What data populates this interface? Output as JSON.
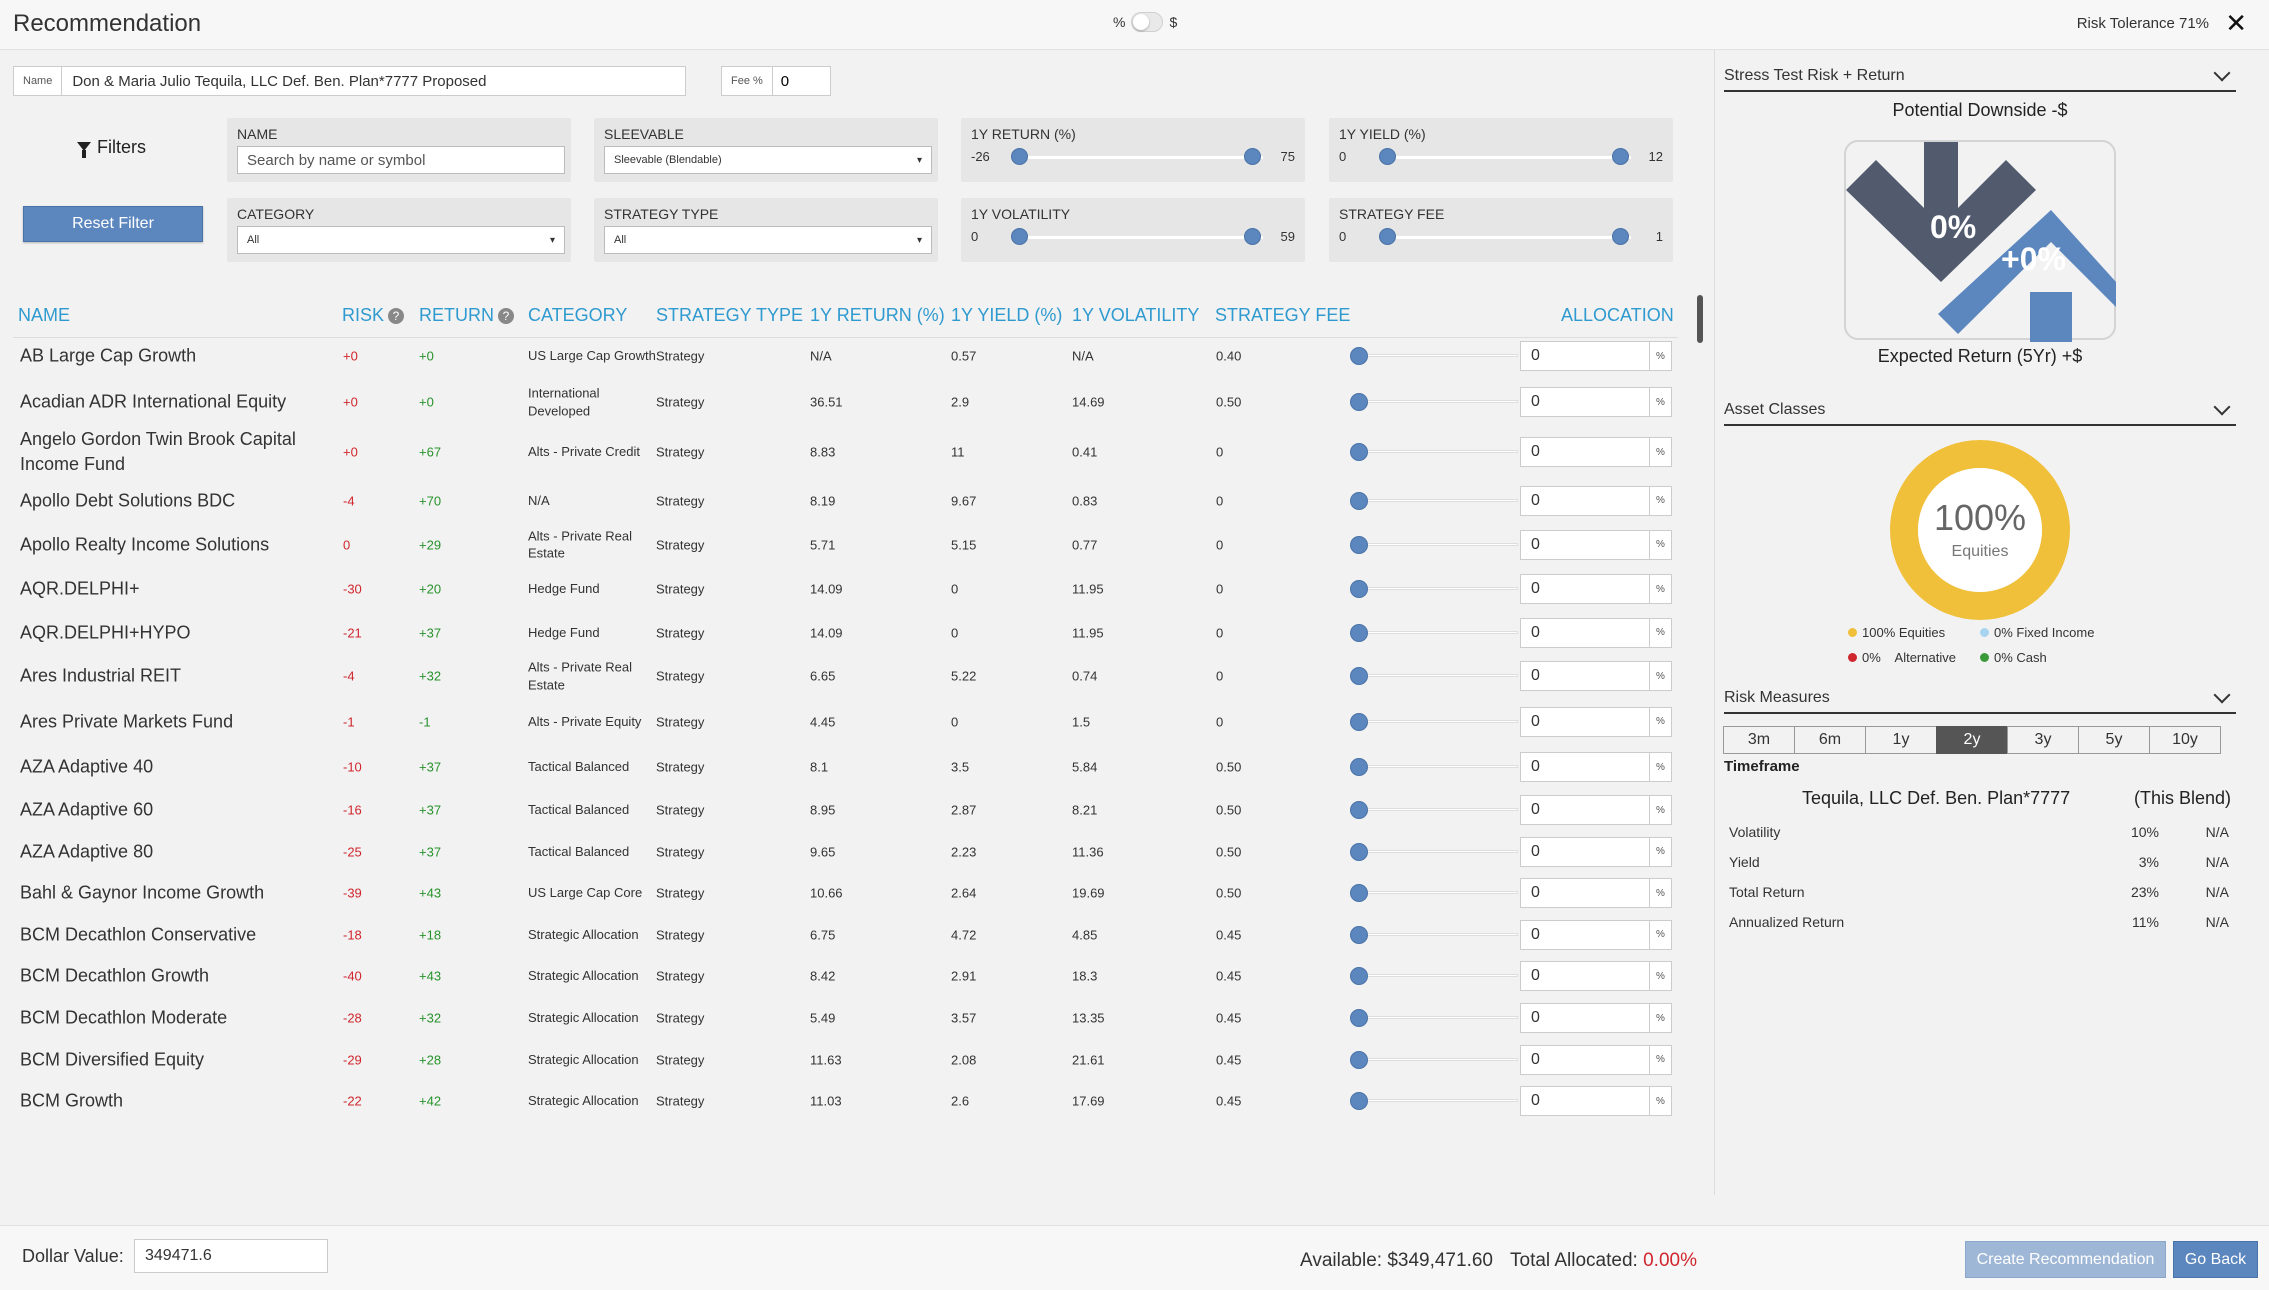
{
  "header": {
    "title": "Recommendation",
    "toggle_left": "%",
    "toggle_right": "$",
    "risk_tolerance": "Risk Tolerance 71%",
    "close_glyph": "✕"
  },
  "form": {
    "name_label": "Name",
    "name_value": "Don & Maria Julio Tequila, LLC Def. Ben. Plan*7777 Proposed",
    "fee_label": "Fee %",
    "fee_value": "0"
  },
  "filters": {
    "title": "Filters",
    "reset_label": "Reset Filter",
    "name": {
      "label": "NAME",
      "placeholder": "Search by name or symbol"
    },
    "sleevable": {
      "label": "SLEEVABLE",
      "selected": "Sleevable (Blendable)"
    },
    "category": {
      "label": "CATEGORY",
      "selected": "All"
    },
    "strategy_type": {
      "label": "STRATEGY TYPE",
      "selected": "All"
    },
    "return_1y": {
      "label": "1Y RETURN (%)",
      "min": "-26",
      "max": "75"
    },
    "yield_1y": {
      "label": "1Y YIELD (%)",
      "min": "0",
      "max": "12"
    },
    "volatility_1y": {
      "label": "1Y VOLATILITY",
      "min": "0",
      "max": "59"
    },
    "strategy_fee": {
      "label": "STRATEGY FEE",
      "min": "0",
      "max": "1"
    }
  },
  "table": {
    "headers": {
      "name": "NAME",
      "risk": "RISK",
      "return": "RETURN",
      "category": "CATEGORY",
      "strategy_type": "STRATEGY TYPE",
      "return_1y": "1Y RETURN (%)",
      "yield_1y": "1Y YIELD (%)",
      "volatility_1y": "1Y VOLATILITY",
      "fee": "STRATEGY FEE",
      "allocation": "ALLOCATION"
    },
    "help_glyph": "?",
    "pct_suffix": "%",
    "rows": [
      {
        "name": "AB Large Cap Growth",
        "risk": "+0",
        "ret": "+0",
        "cat": "US Large Cap Growth",
        "st": "Strategy",
        "r1": "N/A",
        "y1": "0.57",
        "v1": "N/A",
        "fee": "0.40",
        "alloc": "0"
      },
      {
        "name": "Acadian ADR International Equity",
        "risk": "+0",
        "ret": "+0",
        "cat": "International Developed",
        "st": "Strategy",
        "r1": "36.51",
        "y1": "2.9",
        "v1": "14.69",
        "fee": "0.50",
        "alloc": "0"
      },
      {
        "name": "Angelo Gordon Twin Brook Capital Income Fund",
        "risk": "+0",
        "ret": "+67",
        "cat": "Alts - Private Credit",
        "st": "Strategy",
        "r1": "8.83",
        "y1": "11",
        "v1": "0.41",
        "fee": "0",
        "alloc": "0"
      },
      {
        "name": "Apollo Debt Solutions BDC",
        "risk": "-4",
        "ret": "+70",
        "cat": "N/A",
        "st": "Strategy",
        "r1": "8.19",
        "y1": "9.67",
        "v1": "0.83",
        "fee": "0",
        "alloc": "0"
      },
      {
        "name": "Apollo Realty Income Solutions",
        "risk": "0",
        "ret": "+29",
        "cat": "Alts - Private Real Estate",
        "st": "Strategy",
        "r1": "5.71",
        "y1": "5.15",
        "v1": "0.77",
        "fee": "0",
        "alloc": "0"
      },
      {
        "name": "AQR.DELPHI+",
        "risk": "-30",
        "ret": "+20",
        "cat": "Hedge Fund",
        "st": "Strategy",
        "r1": "14.09",
        "y1": "0",
        "v1": "11.95",
        "fee": "0",
        "alloc": "0"
      },
      {
        "name": "AQR.DELPHI+HYPO",
        "risk": "-21",
        "ret": "+37",
        "cat": "Hedge Fund",
        "st": "Strategy",
        "r1": "14.09",
        "y1": "0",
        "v1": "11.95",
        "fee": "0",
        "alloc": "0"
      },
      {
        "name": "Ares Industrial REIT",
        "risk": "-4",
        "ret": "+32",
        "cat": "Alts - Private Real Estate",
        "st": "Strategy",
        "r1": "6.65",
        "y1": "5.22",
        "v1": "0.74",
        "fee": "0",
        "alloc": "0"
      },
      {
        "name": "Ares Private Markets Fund",
        "risk": "-1",
        "ret": "-1",
        "cat": "Alts - Private Equity",
        "st": "Strategy",
        "r1": "4.45",
        "y1": "0",
        "v1": "1.5",
        "fee": "0",
        "alloc": "0"
      },
      {
        "name": "AZA Adaptive 40",
        "risk": "-10",
        "ret": "+37",
        "cat": "Tactical Balanced",
        "st": "Strategy",
        "r1": "8.1",
        "y1": "3.5",
        "v1": "5.84",
        "fee": "0.50",
        "alloc": "0"
      },
      {
        "name": "AZA Adaptive 60",
        "risk": "-16",
        "ret": "+37",
        "cat": "Tactical Balanced",
        "st": "Strategy",
        "r1": "8.95",
        "y1": "2.87",
        "v1": "8.21",
        "fee": "0.50",
        "alloc": "0"
      },
      {
        "name": "AZA Adaptive 80",
        "risk": "-25",
        "ret": "+37",
        "cat": "Tactical Balanced",
        "st": "Strategy",
        "r1": "9.65",
        "y1": "2.23",
        "v1": "11.36",
        "fee": "0.50",
        "alloc": "0"
      },
      {
        "name": "Bahl & Gaynor Income Growth",
        "risk": "-39",
        "ret": "+43",
        "cat": "US Large Cap Core",
        "st": "Strategy",
        "r1": "10.66",
        "y1": "2.64",
        "v1": "19.69",
        "fee": "0.50",
        "alloc": "0"
      },
      {
        "name": "BCM Decathlon Conservative",
        "risk": "-18",
        "ret": "+18",
        "cat": "Strategic Allocation",
        "st": "Strategy",
        "r1": "6.75",
        "y1": "4.72",
        "v1": "4.85",
        "fee": "0.45",
        "alloc": "0"
      },
      {
        "name": "BCM Decathlon Growth",
        "risk": "-40",
        "ret": "+43",
        "cat": "Strategic Allocation",
        "st": "Strategy",
        "r1": "8.42",
        "y1": "2.91",
        "v1": "18.3",
        "fee": "0.45",
        "alloc": "0"
      },
      {
        "name": "BCM Decathlon Moderate",
        "risk": "-28",
        "ret": "+32",
        "cat": "Strategic Allocation",
        "st": "Strategy",
        "r1": "5.49",
        "y1": "3.57",
        "v1": "13.35",
        "fee": "0.45",
        "alloc": "0"
      },
      {
        "name": "BCM Diversified Equity",
        "risk": "-29",
        "ret": "+28",
        "cat": "Strategic Allocation",
        "st": "Strategy",
        "r1": "11.63",
        "y1": "2.08",
        "v1": "21.61",
        "fee": "0.45",
        "alloc": "0"
      },
      {
        "name": "BCM Growth",
        "risk": "-22",
        "ret": "+42",
        "cat": "Strategic Allocation",
        "st": "Strategy",
        "r1": "11.03",
        "y1": "2.6",
        "v1": "17.69",
        "fee": "0.45",
        "alloc": "0"
      }
    ]
  },
  "stress": {
    "header": "Stress Test Risk + Return",
    "downside_title": "Potential Downside -$",
    "downside_pct": "0%",
    "upside_pct": "+0%",
    "expected_return": "Expected Return (5Yr) +$",
    "down_color": "#525a6e",
    "up_color": "#5b86be"
  },
  "asset_classes": {
    "header": "Asset Classes",
    "center_value": "100%",
    "center_label": "Equities",
    "legend": [
      {
        "label": "100% Equities",
        "color": "#f0c03a"
      },
      {
        "label": "0% Fixed Income",
        "color": "#a8d4f0"
      },
      {
        "label": "0%    Alternative",
        "color": "#d0262d"
      },
      {
        "label": "0% Cash",
        "color": "#3a9a3a"
      }
    ]
  },
  "risk_measures": {
    "header": "Risk Measures",
    "timeframes": [
      "3m",
      "6m",
      "1y",
      "2y",
      "3y",
      "5y",
      "10y"
    ],
    "active": "2y",
    "timeframe_label": "Timeframe",
    "col1": "Tequila, LLC Def. Ben. Plan*7777",
    "col2": "(This Blend)",
    "rows": [
      {
        "k": "Volatility",
        "v1": "10%",
        "v2": "N/A"
      },
      {
        "k": "Yield",
        "v1": "3%",
        "v2": "N/A"
      },
      {
        "k": "Total Return",
        "v1": "23%",
        "v2": "N/A"
      },
      {
        "k": "Annualized Return",
        "v1": "11%",
        "v2": "N/A"
      }
    ]
  },
  "footer": {
    "dollar_label": "Dollar Value:",
    "dollar_value": "349471.6",
    "available": "Available: $349,471.60",
    "total_label": "Total Allocated:",
    "total_value": "0.00%",
    "create_label": "Create Recommendation",
    "back_label": "Go Back"
  }
}
